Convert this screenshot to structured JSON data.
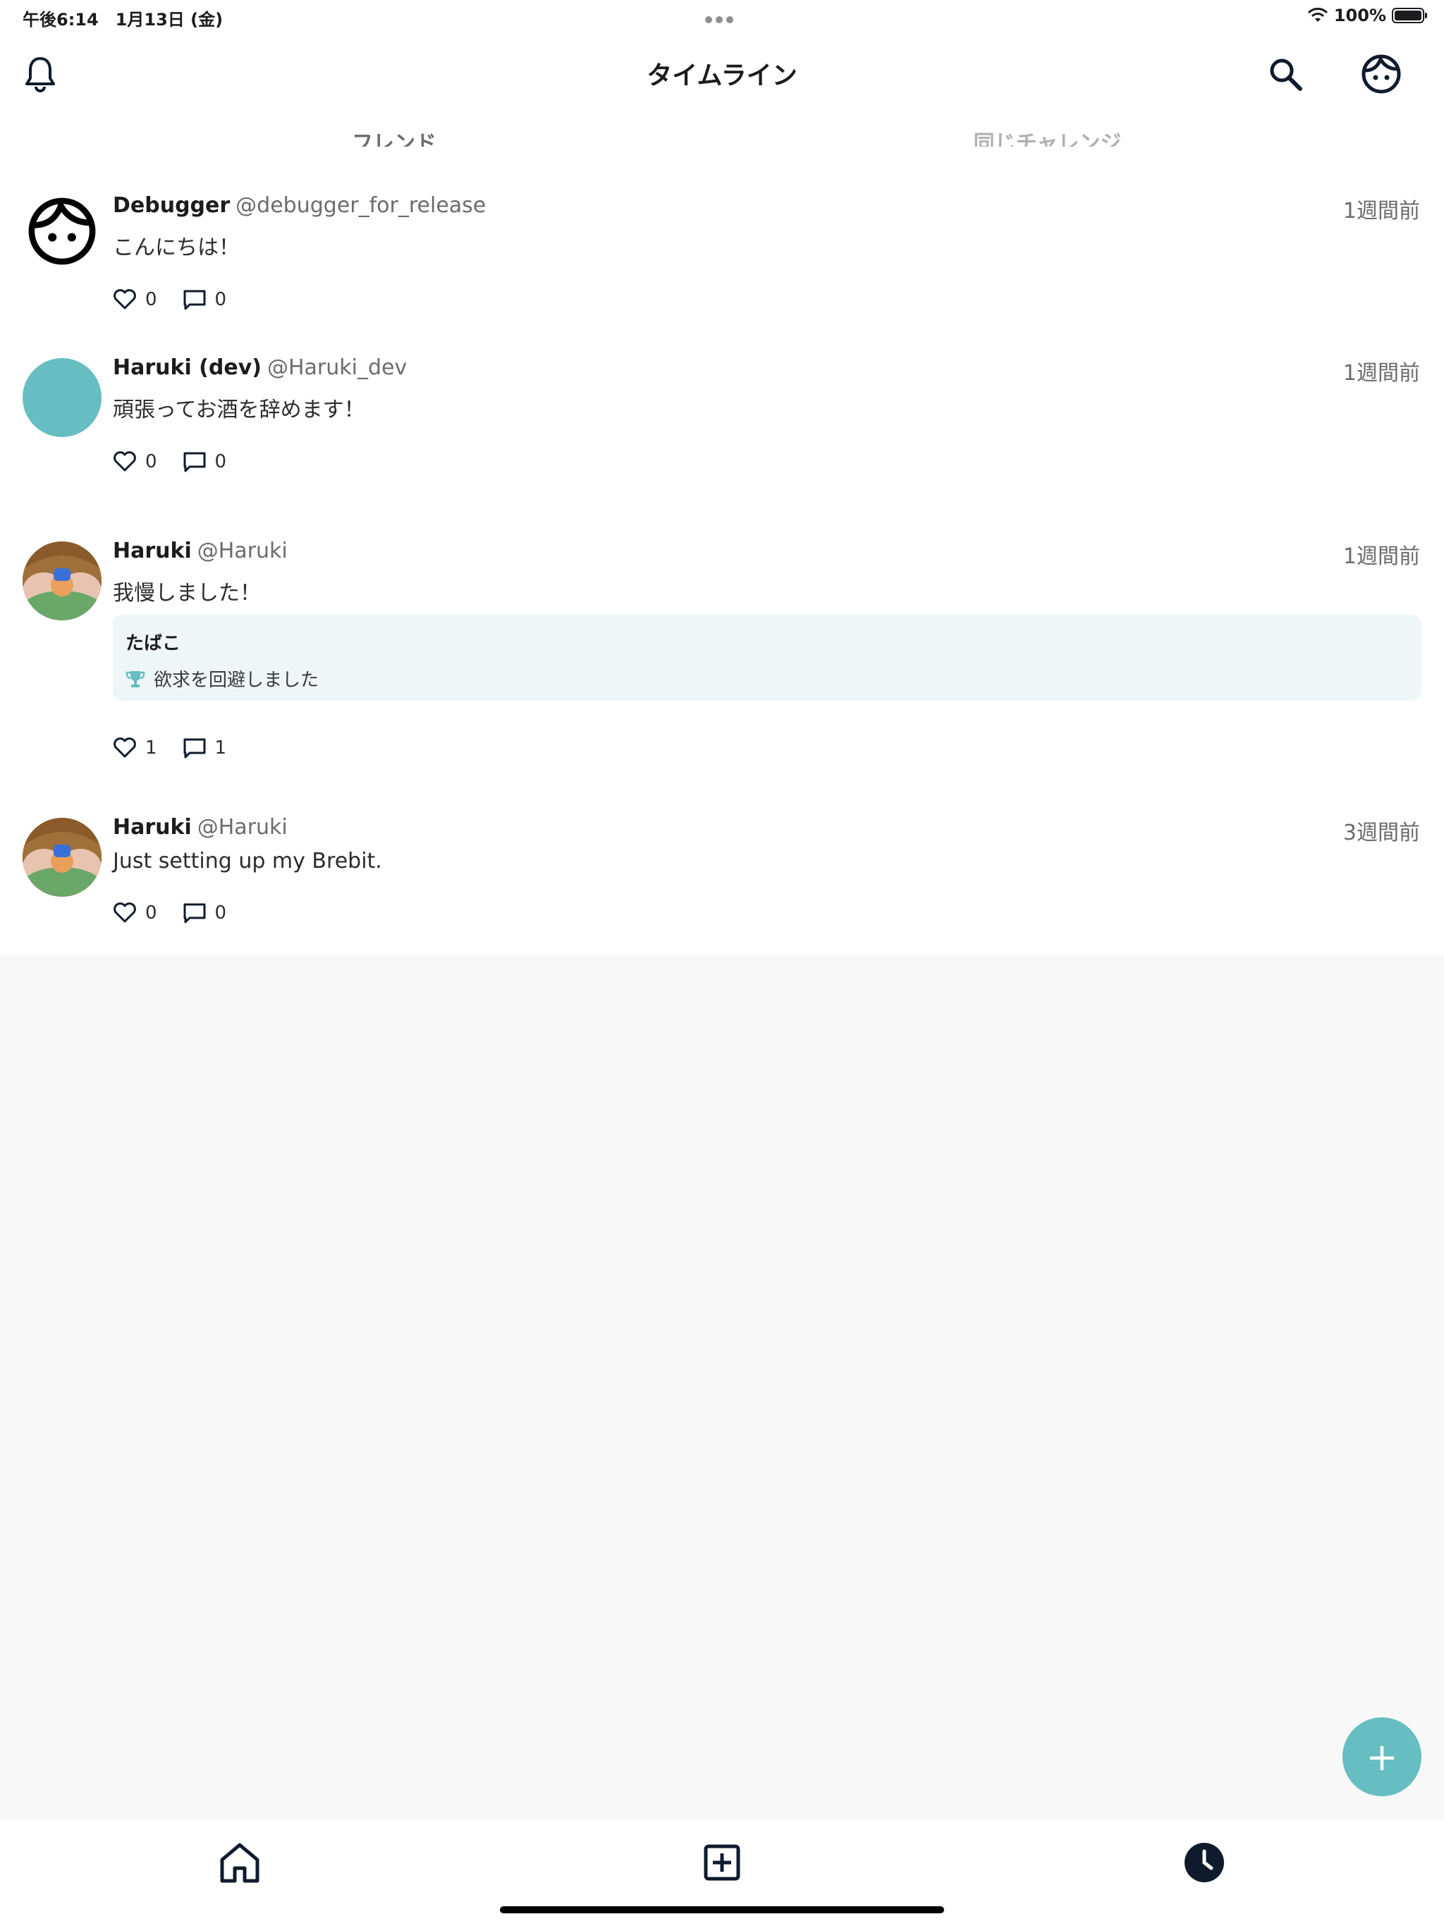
{
  "status_bar": {
    "time": "午後6:14　1月13日 (金)",
    "battery": "100%"
  },
  "header": {
    "title": "タイムライン"
  },
  "tabs": [
    {
      "label": "フレンド",
      "active": true
    },
    {
      "label": "同じチャレンジ",
      "active": false
    }
  ],
  "posts": [
    {
      "name": "Debugger",
      "handle": "@debugger_for_release",
      "time": "1週間前",
      "text": "こんにちは！",
      "likes": "0",
      "comments": "0"
    },
    {
      "name": "Haruki (dev)",
      "handle": "@Haruki_dev",
      "time": "1週間前",
      "text": "頑張ってお酒を辞めます！",
      "likes": "0",
      "comments": "0"
    },
    {
      "name": "Haruki",
      "handle": "@Haruki",
      "time": "1週間前",
      "text": "我慢しました！",
      "likes": "1",
      "comments": "1",
      "challenge": {
        "title": "たばこ",
        "result": "欲求を回避しました"
      }
    },
    {
      "name": "Haruki",
      "handle": "@Haruki",
      "time": "3週間前",
      "text": "Just setting up my Brebit.",
      "likes": "0",
      "comments": "0"
    }
  ],
  "fab": {
    "label": "+"
  },
  "colors": {
    "accent": "#66bec2",
    "card_bg": "#eef6f8",
    "dark": "#0f1b2d"
  }
}
